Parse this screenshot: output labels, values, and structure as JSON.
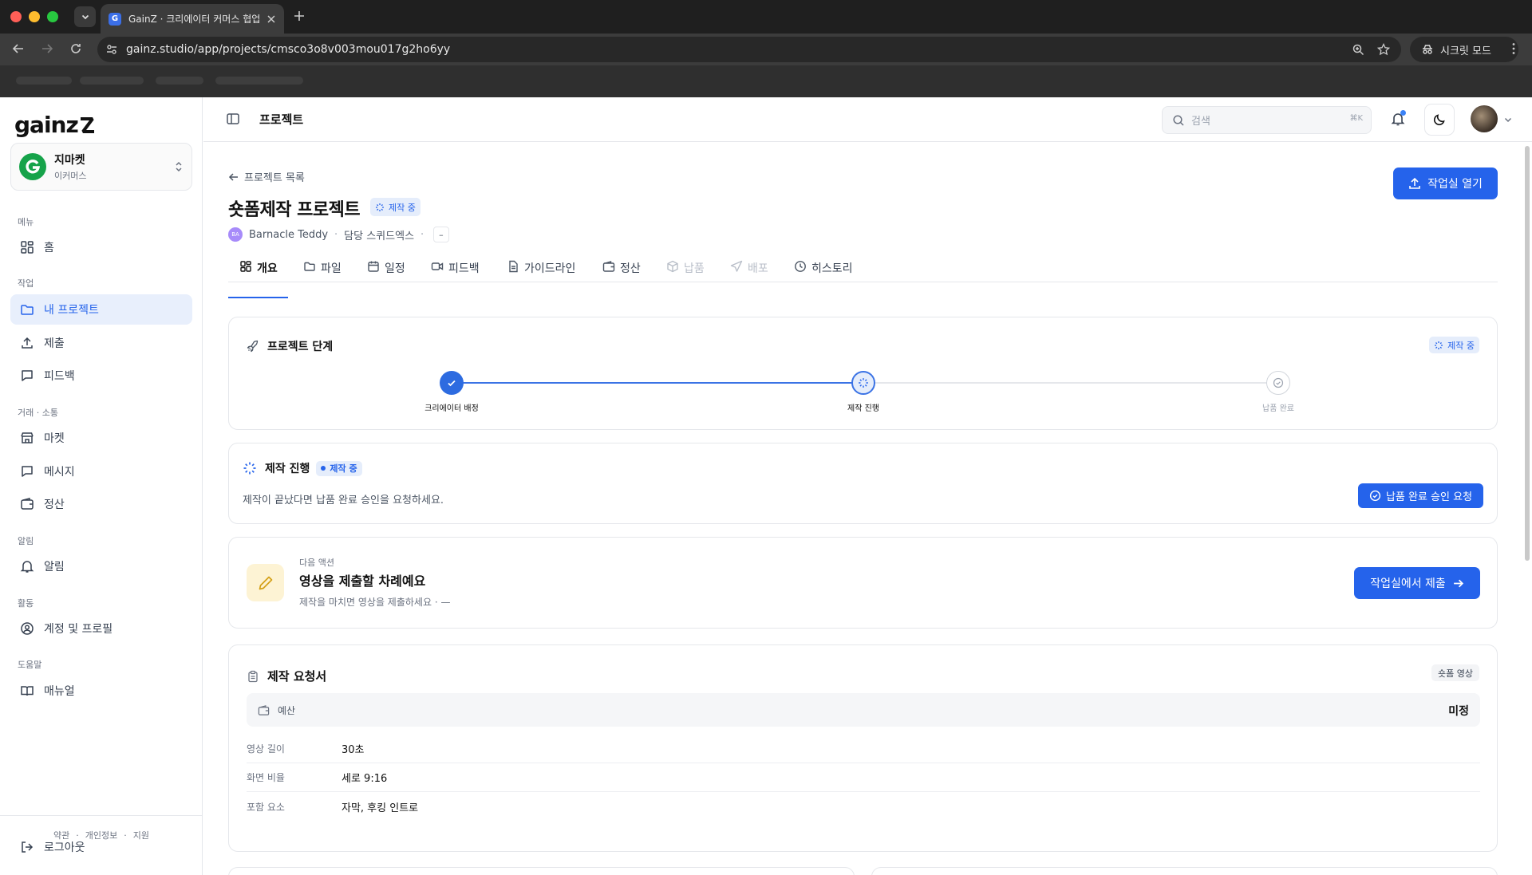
{
  "browser": {
    "tab_title": "GainZ · 크리에이터 커머스 협업 C",
    "tab_favicon_letter": "G",
    "url": "gainz.studio/app/projects/cmsco3o8v003mou017g2ho6yy",
    "incognito_label": "시크릿 모드"
  },
  "sidebar": {
    "logo": "gainz",
    "org": {
      "name": "지마켓",
      "type": "이커머스"
    },
    "sections": {
      "menu": "메뉴",
      "work": "작업",
      "trade": "거래 · 소통",
      "alerts": "알림",
      "activity": "활동",
      "help": "도움말"
    },
    "items": {
      "home": "홈",
      "my_projects": "내 프로젝트",
      "submit": "제출",
      "feedback": "피드백",
      "market": "마켓",
      "messages": "메시지",
      "settlement": "정산",
      "notifications": "알림",
      "account": "계정 및 프로필",
      "manual": "매뉴얼"
    },
    "footer": {
      "terms": "약관",
      "privacy": "개인정보",
      "support": "지원",
      "sep": "·"
    },
    "logout": "로그아웃"
  },
  "header": {
    "title": "프로젝트",
    "search_placeholder": "검색",
    "search_shortcut": "⌘K"
  },
  "project": {
    "back_label": "프로젝트 목록",
    "title": "숏폼제작 프로젝트",
    "status": "제작 중",
    "client_initials": "BA",
    "client_name": "Barnacle Teddy",
    "manager": "담당 스퀴드엑스",
    "extra": "–",
    "open_studio": "작업실 열기"
  },
  "tabs": {
    "overview": "개요",
    "files": "파일",
    "schedule": "일정",
    "feedback": "피드백",
    "guideline": "가이드라인",
    "settlement": "정산",
    "delivery": "납품",
    "distribution": "배포",
    "history": "히스토리"
  },
  "stage": {
    "title": "프로젝트 단계",
    "badge": "제작 중",
    "steps": {
      "assign": "크리에이터 배정",
      "production": "제작 진행",
      "delivered": "납품 완료"
    }
  },
  "production": {
    "title": "제작 진행",
    "badge": "제작 중",
    "desc": "제작이 끝났다면 납품 완료 승인을 요청하세요.",
    "button": "납품 완료 승인 요청"
  },
  "next_action": {
    "kicker": "다음 액션",
    "title": "영상을 제출할 차례예요",
    "desc": "제작을 마치면 영상을 제출하세요 · —",
    "button": "작업실에서 제출"
  },
  "request": {
    "title": "제작 요청서",
    "type": "숏폼 영상",
    "budget_label": "예산",
    "budget_value": "미정",
    "specs": [
      {
        "label": "영상 길이",
        "value": "30초"
      },
      {
        "label": "화면 비율",
        "value": "세로 9:16"
      },
      {
        "label": "포함 요소",
        "value": "자막, 후킹 인트로"
      }
    ]
  },
  "colors": {
    "accent": "#2563eb",
    "accent_soft": "#e5edfb",
    "org_green": "#16a34a"
  }
}
